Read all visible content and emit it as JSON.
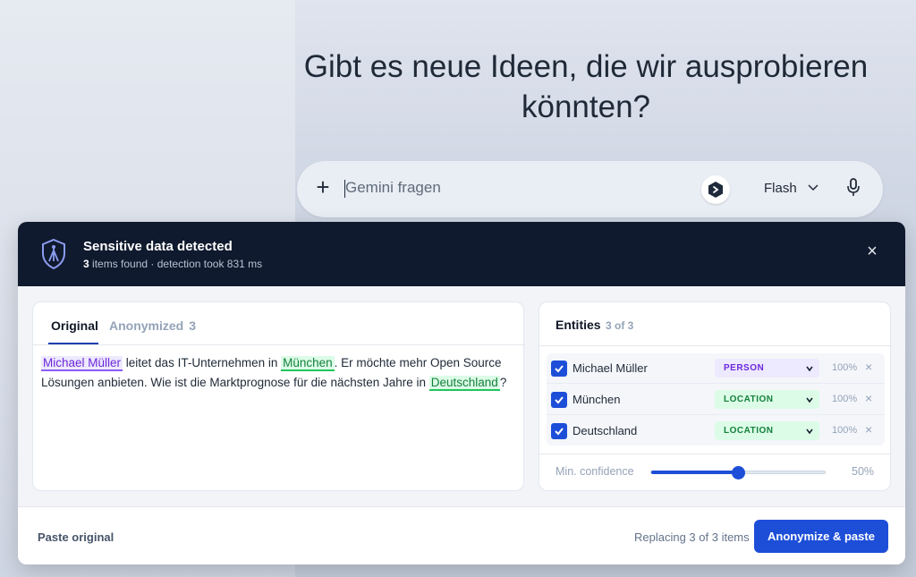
{
  "page": {
    "headline": "Gibt es neue Ideen, die wir ausprobieren könnten?"
  },
  "prompt_bar": {
    "placeholder": "Gemini fragen",
    "model": "Flash",
    "icons": [
      "plus-icon",
      "extension-shield-icon",
      "chevron-down-icon",
      "microphone-icon"
    ]
  },
  "modal": {
    "title": "Sensitive data detected",
    "subtitle_count": "3",
    "subtitle_rest": " items found · detection took 831 ms",
    "close": "×",
    "tabs": {
      "original": "Original",
      "anonymized": "Anonymized",
      "anonymized_count": "3"
    },
    "text": {
      "seg1": "Michael Müller",
      "seg2": " leitet das IT-Unternehmen in ",
      "seg3": "München",
      "seg4": ". Er möchte mehr Open Source Lösungen anbieten. Wie ist die Marktprognose für die nächsten Jahre in ",
      "seg5": "Deutschland",
      "seg6": "?"
    },
    "entities_panel": {
      "title": "Entities",
      "count": "3 of 3",
      "items": [
        {
          "name": "Michael Müller",
          "type": "PERSON",
          "confidence": "100%",
          "checked": true,
          "remove": "×"
        },
        {
          "name": "München",
          "type": "LOCATION",
          "confidence": "100%",
          "checked": true,
          "remove": "×"
        },
        {
          "name": "Deutschland",
          "type": "LOCATION",
          "confidence": "100%",
          "checked": true,
          "remove": "×"
        }
      ],
      "min_confidence_label": "Min. confidence",
      "min_confidence_value": "50%",
      "min_confidence_fraction": 0.5
    },
    "footer": {
      "paste_original": "Paste original",
      "status": "Replacing 3 of 3 items",
      "primary": "Anonymize & paste"
    }
  },
  "colors": {
    "header_bg": "#101a2e",
    "accent": "#1d4ed8",
    "person": "#6d28d9",
    "location": "#15803d"
  }
}
